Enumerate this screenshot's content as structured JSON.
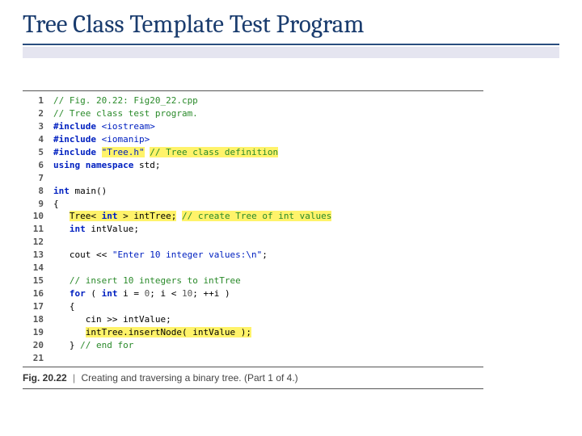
{
  "title": "Tree Class Template Test Program",
  "caption": {
    "label": "Fig. 20.22",
    "sep": "|",
    "text": "Creating and traversing a binary tree.",
    "part": "(Part 1 of 4.)"
  },
  "code": {
    "lines": [
      {
        "n": "1",
        "cls": "",
        "segs": [
          {
            "t": "// Fig. 20.22: Fig20_22.cpp",
            "c": "cm"
          }
        ]
      },
      {
        "n": "2",
        "cls": "",
        "segs": [
          {
            "t": "// Tree class test program.",
            "c": "cm"
          }
        ]
      },
      {
        "n": "3",
        "cls": "",
        "segs": [
          {
            "t": "#include ",
            "c": "kw"
          },
          {
            "t": "<iostream>",
            "c": "st"
          }
        ]
      },
      {
        "n": "4",
        "cls": "",
        "segs": [
          {
            "t": "#include ",
            "c": "kw"
          },
          {
            "t": "<iomanip>",
            "c": "st"
          }
        ]
      },
      {
        "n": "5",
        "cls": "",
        "segs": [
          {
            "t": "#include ",
            "c": "kw"
          },
          {
            "t": "\"Tree.h\"",
            "c": "st hl"
          },
          {
            "t": " ",
            "c": ""
          },
          {
            "t": "// Tree class definition",
            "c": "cm hl"
          }
        ]
      },
      {
        "n": "6",
        "cls": "",
        "segs": [
          {
            "t": "using namespace ",
            "c": "kw"
          },
          {
            "t": "std;",
            "c": ""
          }
        ]
      },
      {
        "n": "7",
        "cls": "",
        "segs": [
          {
            "t": "",
            "c": ""
          }
        ]
      },
      {
        "n": "8",
        "cls": "",
        "segs": [
          {
            "t": "int ",
            "c": "kw"
          },
          {
            "t": "main()",
            "c": ""
          }
        ]
      },
      {
        "n": "9",
        "cls": "",
        "segs": [
          {
            "t": "{",
            "c": ""
          }
        ]
      },
      {
        "n": "10",
        "cls": "",
        "segs": [
          {
            "t": "   ",
            "c": ""
          },
          {
            "t": "Tree< ",
            "c": "hl"
          },
          {
            "t": "int",
            "c": "kw hl"
          },
          {
            "t": " > intTree;",
            "c": "hl"
          },
          {
            "t": " ",
            "c": ""
          },
          {
            "t": "// create Tree of int values",
            "c": "cm hl"
          }
        ]
      },
      {
        "n": "11",
        "cls": "",
        "segs": [
          {
            "t": "   ",
            "c": ""
          },
          {
            "t": "int ",
            "c": "kw"
          },
          {
            "t": "intValue;",
            "c": ""
          }
        ]
      },
      {
        "n": "12",
        "cls": "",
        "segs": [
          {
            "t": "",
            "c": ""
          }
        ]
      },
      {
        "n": "13",
        "cls": "",
        "segs": [
          {
            "t": "   cout << ",
            "c": ""
          },
          {
            "t": "\"Enter 10 integer values:\\n\"",
            "c": "st"
          },
          {
            "t": ";",
            "c": ""
          }
        ]
      },
      {
        "n": "14",
        "cls": "",
        "segs": [
          {
            "t": "",
            "c": ""
          }
        ]
      },
      {
        "n": "15",
        "cls": "",
        "segs": [
          {
            "t": "   ",
            "c": ""
          },
          {
            "t": "// insert 10 integers to intTree",
            "c": "cm"
          }
        ]
      },
      {
        "n": "16",
        "cls": "",
        "segs": [
          {
            "t": "   ",
            "c": ""
          },
          {
            "t": "for ",
            "c": "kw"
          },
          {
            "t": "( ",
            "c": ""
          },
          {
            "t": "int ",
            "c": "kw"
          },
          {
            "t": "i = ",
            "c": ""
          },
          {
            "t": "0",
            "c": "num"
          },
          {
            "t": "; i < ",
            "c": ""
          },
          {
            "t": "10",
            "c": "num"
          },
          {
            "t": "; ++i )",
            "c": ""
          }
        ]
      },
      {
        "n": "17",
        "cls": "",
        "segs": [
          {
            "t": "   {",
            "c": ""
          }
        ]
      },
      {
        "n": "18",
        "cls": "",
        "segs": [
          {
            "t": "      cin >> intValue;",
            "c": ""
          }
        ]
      },
      {
        "n": "19",
        "cls": "",
        "segs": [
          {
            "t": "      ",
            "c": ""
          },
          {
            "t": "intTree.insertNode( intValue );",
            "c": "hl"
          }
        ]
      },
      {
        "n": "20",
        "cls": "",
        "segs": [
          {
            "t": "   } ",
            "c": ""
          },
          {
            "t": "// end for",
            "c": "cm"
          }
        ]
      },
      {
        "n": "21",
        "cls": "",
        "segs": [
          {
            "t": "",
            "c": ""
          }
        ]
      }
    ]
  }
}
